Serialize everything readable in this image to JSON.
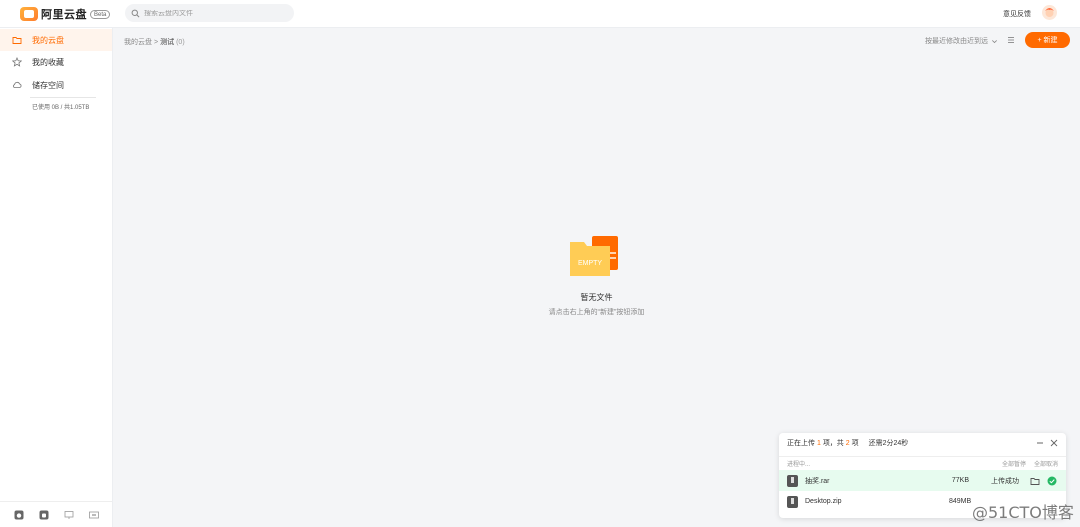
{
  "app": {
    "name": "阿里云盘",
    "badge": "Beta"
  },
  "search": {
    "placeholder": "搜索云盘内文件"
  },
  "header": {
    "feedback": "意见反馈"
  },
  "sidebar": {
    "items": [
      {
        "label": "我的云盘",
        "icon": "folder-icon",
        "active": true
      },
      {
        "label": "我的收藏",
        "icon": "star-icon",
        "active": false
      },
      {
        "label": "储存空间",
        "icon": "cloud-icon",
        "active": false
      }
    ],
    "storage_text": "已使用 0B / 共1.05TB"
  },
  "breadcrumb": {
    "root": "我的云盘",
    "sep": ">",
    "current": "测试",
    "count": "(0)"
  },
  "toolbar": {
    "sort_label": "按最近修改由近到远",
    "new_label": "新建"
  },
  "empty": {
    "illustration_text": "EMPTY",
    "title": "暂无文件",
    "hint": "请点击右上角的“新建”按钮添加"
  },
  "upload": {
    "status_prefix": "正在上传",
    "current": "1",
    "mid": "项，共",
    "total": "2",
    "suffix": "项",
    "remaining": "还需2分24秒",
    "progress_label": "进程中...",
    "pause_all": "全部暂停",
    "cancel_all": "全部取消",
    "files": [
      {
        "name": "抽奖.rar",
        "size": "77KB",
        "status": "上传成功",
        "done": true
      },
      {
        "name": "Desktop.zip",
        "size": "849MB",
        "status": "",
        "done": false
      }
    ]
  },
  "watermark": "@51CTO博客",
  "colors": {
    "accent": "#ff6a00",
    "success": "#25b864",
    "success_bg": "#e7fbef"
  }
}
